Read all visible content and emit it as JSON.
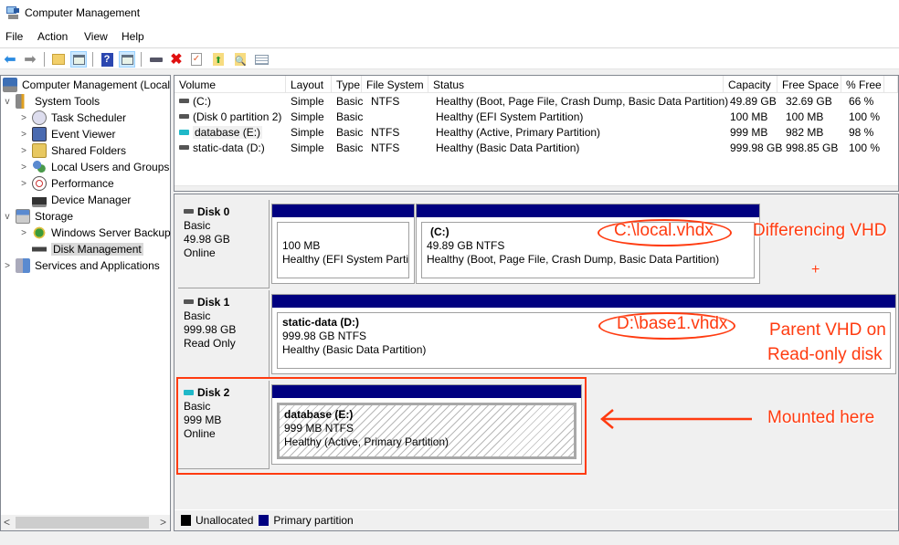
{
  "window": {
    "title": "Computer Management"
  },
  "menu": {
    "items": [
      "File",
      "Action",
      "View",
      "Help"
    ]
  },
  "toolbar": {
    "buttons": [
      {
        "name": "back-arrow-icon"
      },
      {
        "name": "forward-arrow-icon"
      },
      {
        "name": "up-folder-icon"
      },
      {
        "name": "show-hide-console-tree-icon"
      },
      {
        "name": "help-icon"
      },
      {
        "name": "show-hide-action-pane-icon"
      },
      {
        "name": "connect-drive-icon"
      },
      {
        "name": "delete-icon"
      },
      {
        "name": "properties-check-icon"
      },
      {
        "name": "export-folder-icon"
      },
      {
        "name": "search-folder-icon"
      },
      {
        "name": "list-settings-icon"
      }
    ]
  },
  "tree": {
    "items": [
      {
        "label": "Computer Management (Local",
        "level": 0,
        "expander": ""
      },
      {
        "label": "System Tools",
        "level": 1,
        "expander": "v"
      },
      {
        "label": "Task Scheduler",
        "level": 2,
        "expander": ">"
      },
      {
        "label": "Event Viewer",
        "level": 2,
        "expander": ">"
      },
      {
        "label": "Shared Folders",
        "level": 2,
        "expander": ">"
      },
      {
        "label": "Local Users and Groups",
        "level": 2,
        "expander": ">"
      },
      {
        "label": "Performance",
        "level": 2,
        "expander": ">"
      },
      {
        "label": "Device Manager",
        "level": 2,
        "expander": ""
      },
      {
        "label": "Storage",
        "level": 1,
        "expander": "v"
      },
      {
        "label": "Windows Server Backup",
        "level": 2,
        "expander": ">"
      },
      {
        "label": "Disk Management",
        "level": 2,
        "expander": "",
        "selected": true
      },
      {
        "label": "Services and Applications",
        "level": 1,
        "expander": ">"
      }
    ]
  },
  "volumes": {
    "columns": [
      "Volume",
      "Layout",
      "Type",
      "File System",
      "Status",
      "Capacity",
      "Free Space",
      "% Free"
    ],
    "rows": [
      [
        "(C:)",
        "Simple",
        "Basic",
        "NTFS",
        "Healthy (Boot, Page File, Crash Dump, Basic Data Partition)",
        "49.89 GB",
        "32.69 GB",
        "66 %"
      ],
      [
        "(Disk 0 partition 2)",
        "Simple",
        "Basic",
        "",
        "Healthy (EFI System Partition)",
        "100 MB",
        "100 MB",
        "100 %"
      ],
      [
        "database (E:)",
        "Simple",
        "Basic",
        "NTFS",
        "Healthy (Active, Primary Partition)",
        "999 MB",
        "982 MB",
        "98 %"
      ],
      [
        "static-data (D:)",
        "Simple",
        "Basic",
        "NTFS",
        "Healthy (Basic Data Partition)",
        "999.98 GB",
        "998.85 GB",
        "100 %"
      ]
    ]
  },
  "disks": [
    {
      "name": "Disk 0",
      "type": "Basic",
      "size": "49.98 GB",
      "state": "Online",
      "partitions": [
        {
          "label": "",
          "size": "100 MB",
          "status": "Healthy (EFI System Partitic"
        },
        {
          "label": "(C:)",
          "size": "49.89 GB NTFS",
          "status": "Healthy (Boot, Page File, Crash Dump, Basic Data Partition)"
        }
      ]
    },
    {
      "name": "Disk 1",
      "type": "Basic",
      "size": "999.98 GB",
      "state": "Read Only",
      "partitions": [
        {
          "label": "static-data  (D:)",
          "size": "999.98 GB NTFS",
          "status": "Healthy (Basic Data Partition)"
        }
      ]
    },
    {
      "name": "Disk 2",
      "type": "Basic",
      "size": "999 MB",
      "state": "Online",
      "partitions": [
        {
          "label": "database  (E:)",
          "size": "999 MB NTFS",
          "status": "Healthy (Active, Primary Partition)"
        }
      ]
    }
  ],
  "legend": [
    {
      "label": "Unallocated",
      "color": "#000000"
    },
    {
      "label": "Primary partition",
      "color": "#000080"
    }
  ],
  "annotations": {
    "local_vhdx": "C:\\local.vhdx",
    "differencing": "Differencing VHD",
    "plus": "+",
    "base_vhdx": "D:\\base1.vhdx",
    "parent_line1": "Parent VHD on",
    "parent_line2": "Read-only disk",
    "mounted": "Mounted here",
    "color": "#ff3b10"
  }
}
